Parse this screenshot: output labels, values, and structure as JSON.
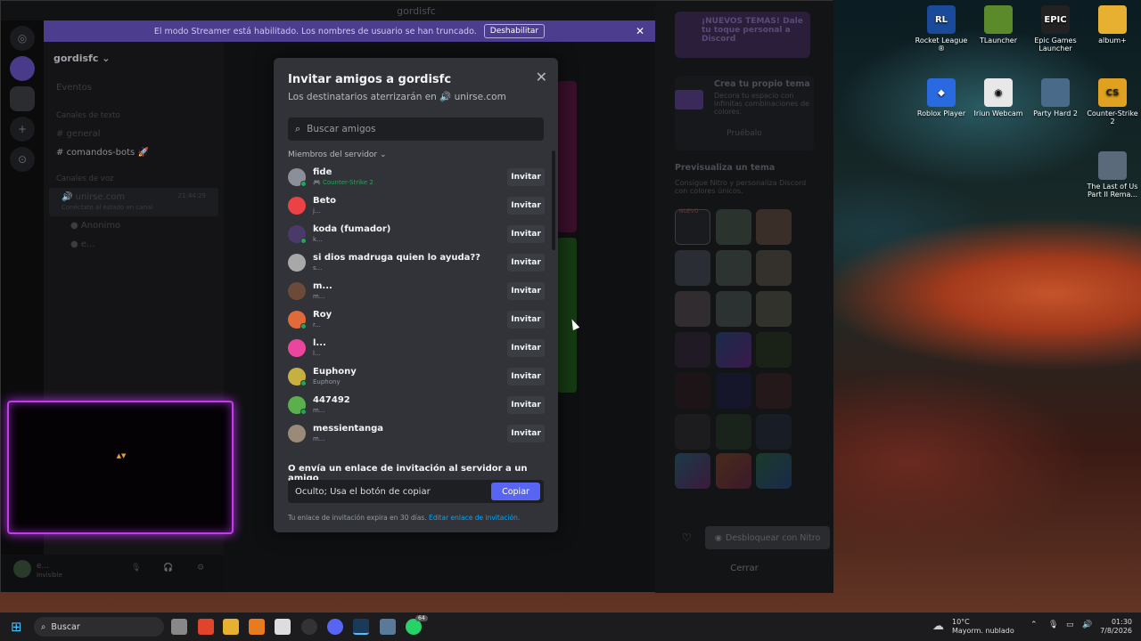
{
  "window": {
    "title": "gordisfc"
  },
  "streamer_banner": {
    "text": "El modo Streamer está habilitado. Los nombres de usuario se han truncado.",
    "button": "Deshabilitar"
  },
  "sidebar": {
    "server_name": "gordisfc",
    "events": "Eventos",
    "text_header": "Canales de texto",
    "channels": [
      "general",
      "comandos-bots 🚀"
    ],
    "voice_header": "Canales de voz",
    "voice_channel": "unirse.com",
    "voice_time": "21:44:29",
    "voice_status": "Conéctate al estado en canal",
    "voice_users": [
      "Anonimo",
      "e..."
    ],
    "user": {
      "name": "e...",
      "status": "Invisible"
    }
  },
  "right_panel": {
    "promo_title": "¡NUEVOS TEMAS! Dale tu toque personal a Discord",
    "create_title": "Crea tu propio tema",
    "create_desc": "Decora tu espacio con infinitas combinaciones de colores.",
    "try_label": "Pruébalo",
    "preview_title": "Previsualiza un tema",
    "preview_desc": "Consigue Nitro y personaliza Discord con colores únicos.",
    "new_badge": "NUEVO",
    "unlock_button": "Desbloquear con Nitro",
    "close_button": "Cerrar"
  },
  "modal": {
    "title": "Invitar amigos a gordisfc",
    "subtitle": "Los destinatarios aterrizarán en",
    "channel": "unirse.com",
    "search_placeholder": "Buscar amigos",
    "section_label": "Miembros del servidor",
    "invite_label": "Invitar",
    "members": [
      {
        "name": "fide",
        "status": "Counter-Strike 2",
        "avatar_color": "#8a8f99",
        "online": true,
        "game": true
      },
      {
        "name": "Beto",
        "status": "j...",
        "avatar_color": "#ed4245",
        "online": false,
        "game": false
      },
      {
        "name": "koda (fumador)",
        "status": "k...",
        "avatar_color": "#4a3a6a",
        "online": true,
        "game": false
      },
      {
        "name": "si dios madruga quien lo ayuda??",
        "status": "s...",
        "avatar_color": "#a8a8a8",
        "online": false,
        "game": false
      },
      {
        "name": "m...",
        "status": "m...",
        "avatar_color": "#6b4a3a",
        "online": false,
        "game": false
      },
      {
        "name": "Roy",
        "status": "r...",
        "avatar_color": "#e06a3a",
        "online": true,
        "game": false
      },
      {
        "name": "l...",
        "status": "l...",
        "avatar_color": "#eb459e",
        "online": false,
        "game": false
      },
      {
        "name": "Euphony",
        "status": "Euphony",
        "avatar_color": "#c8b040",
        "online": true,
        "game": false
      },
      {
        "name": "447492",
        "status": "m...",
        "avatar_color": "#5ab04a",
        "online": true,
        "game": false
      },
      {
        "name": "messientanga",
        "status": "m...",
        "avatar_color": "#9a8a7a",
        "online": false,
        "game": false
      }
    ],
    "footer_heading": "O envía un enlace de invitación al servidor a un amigo",
    "link_value": "Oculto; Usa el botón de copiar",
    "copy_button": "Copiar",
    "expire_text": "Tu enlace de invitación expira en 30 días.",
    "edit_link": "Editar enlace de invitación."
  },
  "desktop_icons": [
    {
      "label": "Rocket League ®",
      "color": "#1a4a9a"
    },
    {
      "label": "TLauncher",
      "color": "#5a8a2a"
    },
    {
      "label": "Epic Games Launcher",
      "color": "#222222"
    },
    {
      "label": "album+",
      "color": "#e8b030"
    },
    {
      "label": "Roblox Player",
      "color": "#2a6ae0"
    },
    {
      "label": "Iriun Webcam",
      "color": "#e8e8e8"
    },
    {
      "label": "Party Hard 2",
      "color": "#4a6a8a"
    },
    {
      "label": "Counter-Strike 2",
      "color": "#e0a020"
    },
    {
      "label": "The Last of Us Part II Rema...",
      "color": "#5a6a7a"
    }
  ],
  "taskbar": {
    "search_label": "Buscar",
    "weather_temp": "10°C",
    "weather_desc": "Mayorm. nublado",
    "time": "01:30",
    "date": "7/8/2026",
    "badge": "64"
  }
}
